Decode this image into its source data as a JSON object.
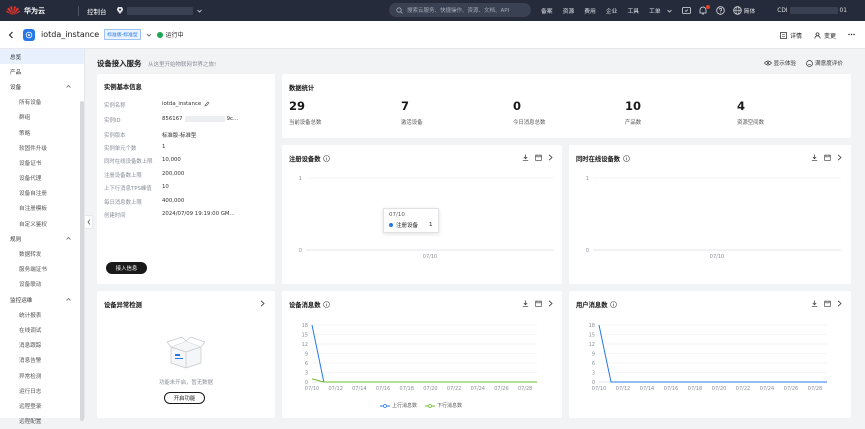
{
  "topbar": {
    "brand": "华为云",
    "console": "控制台",
    "search_placeholder": "搜索云服务、快捷操作、资源、文档、API",
    "links": [
      "备案",
      "资源",
      "费用",
      "企业",
      "工具",
      "工单"
    ],
    "lang": "简体",
    "account": "CDI",
    "account_suffix": "01"
  },
  "instance": {
    "name": "iotda_instance",
    "tag": "标准版-标准型",
    "status": "运行中",
    "actions": [
      "详情",
      "变更"
    ]
  },
  "sidebar": {
    "items": [
      {
        "label": "总览",
        "level": 0,
        "active": true
      },
      {
        "label": "产品",
        "level": 0
      },
      {
        "label": "设备",
        "level": 0,
        "group": true
      },
      {
        "label": "所有设备",
        "level": 1
      },
      {
        "label": "群组",
        "level": 1
      },
      {
        "label": "策略",
        "level": 1
      },
      {
        "label": "软固件升级",
        "level": 1
      },
      {
        "label": "设备证书",
        "level": 1
      },
      {
        "label": "设备代理",
        "level": 1
      },
      {
        "label": "设备自注册",
        "level": 1
      },
      {
        "label": "自注册模板",
        "level": 1
      },
      {
        "label": "自定义鉴权",
        "level": 1
      },
      {
        "label": "规则",
        "level": 0,
        "group": true
      },
      {
        "label": "数据转发",
        "level": 1
      },
      {
        "label": "服务端证书",
        "level": 1
      },
      {
        "label": "设备联动",
        "level": 1
      },
      {
        "label": "监控运维",
        "level": 0,
        "group": true
      },
      {
        "label": "统计报表",
        "level": 1
      },
      {
        "label": "在线调试",
        "level": 1
      },
      {
        "label": "消息跟踪",
        "level": 1
      },
      {
        "label": "消息告警",
        "level": 1
      },
      {
        "label": "异常检测",
        "level": 1
      },
      {
        "label": "运行日志",
        "level": 1
      },
      {
        "label": "远程登录",
        "level": 1
      },
      {
        "label": "远程配置",
        "level": 1
      }
    ]
  },
  "page": {
    "title": "设备接入服务",
    "subtitle": "从这里开始物联网世界之旅!",
    "actions": [
      "显示体验",
      "满意度评价"
    ]
  },
  "basic_info": {
    "title": "实例基本信息",
    "rows": [
      {
        "k": "实例名称",
        "v": "iotda_instance"
      },
      {
        "k": "实例ID",
        "v": "856167",
        "v2": "9c..."
      },
      {
        "k": "实例版本",
        "v": "标准版-标准型"
      },
      {
        "k": "实例单元个数",
        "v": "1"
      },
      {
        "k": "同时在线设备数上限",
        "v": "10,000"
      },
      {
        "k": "注册设备数上限",
        "v": "200,000"
      },
      {
        "k": "上下行消息TPS峰值",
        "v": "10"
      },
      {
        "k": "每日消息数上限",
        "v": "400,000"
      },
      {
        "k": "创建时间",
        "v": "2024/07/09 19:19:00 GM..."
      }
    ],
    "button": "接入信息"
  },
  "stats": {
    "title": "数据统计",
    "items": [
      {
        "num": "29",
        "label": "当前设备总数"
      },
      {
        "num": "7",
        "label": "激活设备"
      },
      {
        "num": "0",
        "label": "今日消息总数"
      },
      {
        "num": "10",
        "label": "产品数"
      },
      {
        "num": "4",
        "label": "资源空间数"
      }
    ]
  },
  "anomaly": {
    "title": "设备异常检测",
    "empty": "功能未开启，暂无数据",
    "button": "开启功能"
  },
  "colors": {
    "accent": "#2678e8",
    "green": "#6bbf2a",
    "topbar": "#252b3a",
    "status": "#1ea654"
  },
  "chart_data": [
    {
      "type": "line",
      "title": "注册设备数",
      "x": [
        "07/10"
      ],
      "ylim": [
        0,
        1
      ],
      "yticks": [
        "0",
        "1"
      ],
      "series": [
        {
          "name": "注册设备",
          "values": [
            1
          ]
        }
      ],
      "tooltip": {
        "x": "07/10",
        "name": "注册设备",
        "value": "1"
      }
    },
    {
      "type": "line",
      "title": "同时在线设备数",
      "x": [
        "07/10"
      ],
      "ylim": [
        0,
        1
      ],
      "yticks": [
        "0",
        "1"
      ],
      "series": [
        {
          "values": [
            0
          ]
        }
      ]
    },
    {
      "type": "line",
      "title": "设备消息数",
      "x": [
        "07/10",
        "07/11",
        "07/12",
        "07/13",
        "07/14",
        "07/15",
        "07/16",
        "07/17",
        "07/18",
        "07/19",
        "07/20",
        "07/21",
        "07/22",
        "07/23",
        "07/24",
        "07/25",
        "07/26",
        "07/27",
        "07/28",
        "07/29"
      ],
      "xticks": [
        "07/10",
        "07/12",
        "07/14",
        "07/16",
        "07/18",
        "07/20",
        "07/22",
        "07/24",
        "07/26",
        "07/28"
      ],
      "ylim": [
        0,
        18
      ],
      "yticks": [
        "0",
        "3",
        "6",
        "9",
        "12",
        "15",
        "18"
      ],
      "series": [
        {
          "name": "上行消息数",
          "color": "#2678e8",
          "values": [
            18,
            0,
            0,
            0,
            0,
            0,
            0,
            0,
            0,
            0,
            0,
            0,
            0,
            0,
            0,
            0,
            0,
            0,
            0,
            0
          ]
        },
        {
          "name": "下行消息数",
          "color": "#6bbf2a",
          "values": [
            1,
            0,
            0,
            0,
            0,
            0,
            0,
            0,
            0,
            0,
            0,
            0,
            0,
            0,
            0,
            0,
            0,
            0,
            0,
            0
          ]
        }
      ]
    },
    {
      "type": "line",
      "title": "用户消息数",
      "x": [
        "07/10",
        "07/11",
        "07/12",
        "07/13",
        "07/14",
        "07/15",
        "07/16",
        "07/17",
        "07/18",
        "07/19",
        "07/20",
        "07/21",
        "07/22",
        "07/23",
        "07/24",
        "07/25",
        "07/26",
        "07/27",
        "07/28",
        "07/29"
      ],
      "xticks": [
        "07/10",
        "07/12",
        "07/14",
        "07/16",
        "07/18",
        "07/20",
        "07/22",
        "07/24",
        "07/26",
        "07/28"
      ],
      "ylim": [
        0,
        18
      ],
      "yticks": [
        "0",
        "3",
        "6",
        "9",
        "12",
        "15",
        "18"
      ],
      "series": [
        {
          "color": "#2678e8",
          "values": [
            18,
            0,
            0,
            0,
            0,
            0,
            0,
            0,
            0,
            0,
            0,
            0,
            0,
            0,
            0,
            0,
            0,
            0,
            0,
            0
          ]
        }
      ]
    }
  ]
}
